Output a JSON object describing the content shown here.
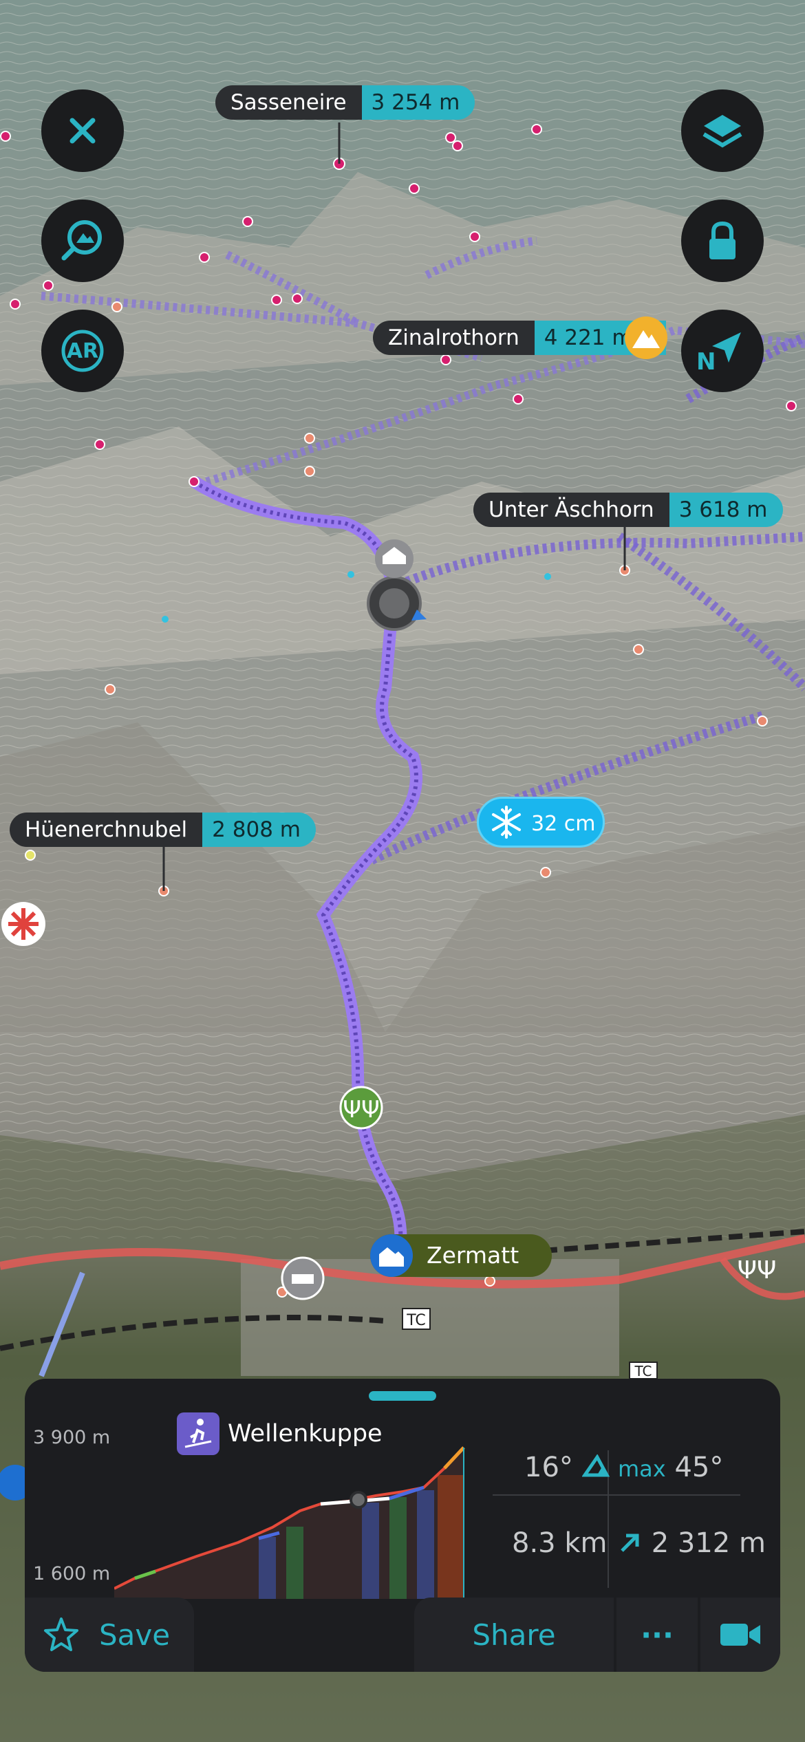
{
  "map": {
    "peaks": [
      {
        "name": "Sasseneire",
        "elevation": "3 254 m"
      },
      {
        "name": "Zinalrothorn",
        "elevation": "4 221 m"
      },
      {
        "name": "Unter Äschhorn",
        "elevation": "3 618 m"
      },
      {
        "name": "Hüenerchnubel",
        "elevation": "2 808 m"
      }
    ],
    "snow_depth": "32 cm",
    "place": "Zermatt",
    "tc_labels": [
      "TC",
      "TC"
    ]
  },
  "controls": {
    "close": "close-icon",
    "search_peak": "mountain-search-icon",
    "ar_label": "AR",
    "layers": "layers-icon",
    "lock": "lock-icon",
    "compass_label": "N"
  },
  "route": {
    "name": "Wellenkuppe",
    "icon": "ski-touring-icon",
    "elev_max_label": "3 900 m",
    "elev_min_label": "1 600 m",
    "slope": "16°",
    "max_label": "max",
    "max_slope": "45°",
    "distance": "8.3 km",
    "ascent": "2 312 m"
  },
  "actions": {
    "save": "Save",
    "share": "Share",
    "more": "···"
  },
  "colors": {
    "accent": "#2bb4c4",
    "route": "#8a6cd8",
    "sheet": "#1c1d20"
  }
}
